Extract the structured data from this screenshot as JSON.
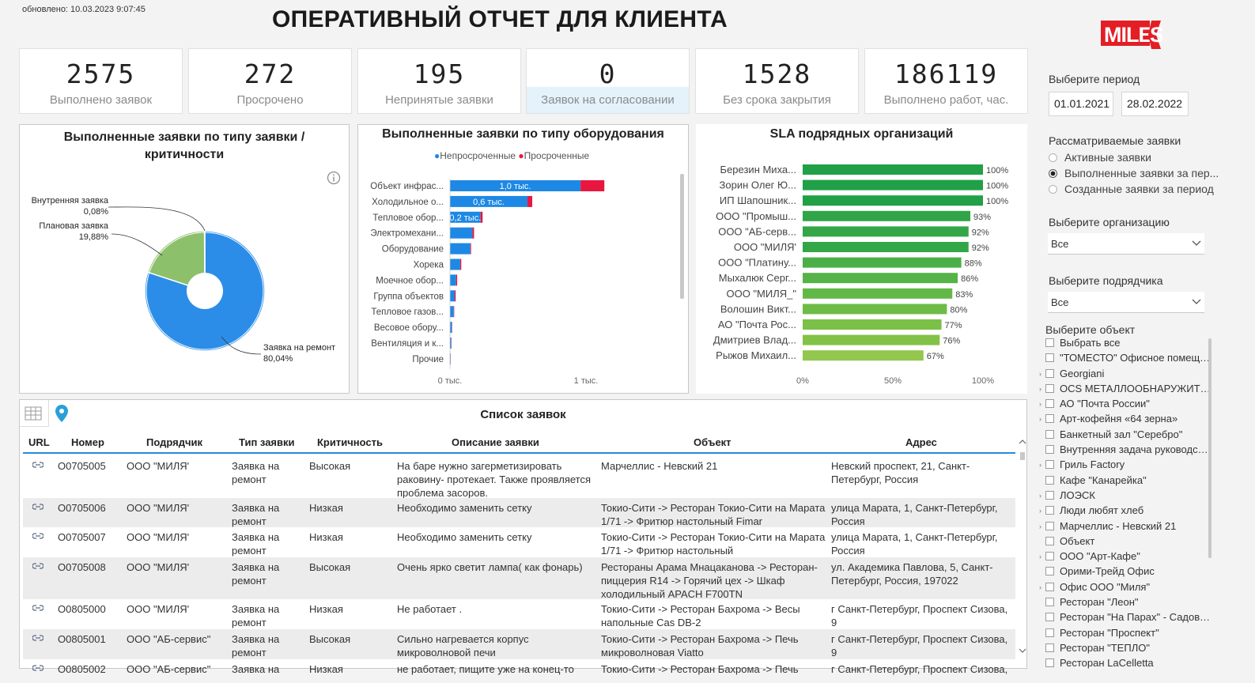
{
  "header": {
    "updated": "обновлено: 10.03.2023 9:07:45",
    "title": "ОПЕРАТИВНЫЙ ОТЧЕТ ДЛЯ КЛИЕНТА",
    "logo_text": "MILES",
    "logo_color": "#e31e24"
  },
  "kpis": [
    {
      "value": "2575",
      "label": "Выполнено заявок"
    },
    {
      "value": "272",
      "label": "Просрочено"
    },
    {
      "value": "195",
      "label": "Непринятые заявки"
    },
    {
      "value": "0",
      "label": "Заявок на согласовании"
    },
    {
      "value": "1528",
      "label": "Без срока закрытия"
    },
    {
      "value": "186119",
      "label": "Выполнено работ, час."
    }
  ],
  "pie": {
    "title": "Выполненные заявки по типу заявки / критичности",
    "slices": [
      {
        "label": "Заявка на ремонт",
        "pct": "80,04%",
        "value": 80.04,
        "color": "#2b8de8"
      },
      {
        "label": "Плановая заявка",
        "pct": "19,88%",
        "value": 19.88,
        "color": "#8cc06b"
      },
      {
        "label": "Внутренняя заявка",
        "pct": "0,08%",
        "value": 0.08,
        "color": "#555555"
      }
    ]
  },
  "equip": {
    "title": "Выполненные заявки по типу оборудования",
    "legend": [
      "Непросроченные",
      "Просроченные"
    ],
    "colors": [
      "#1e88e5",
      "#e8173f"
    ],
    "categories": [
      "Объект инфрас...",
      "Холодильное о...",
      "Тепловое обор...",
      "Электромехани...",
      "Оборудование",
      "Хорека",
      "Моечное обор...",
      "Группа объектов",
      "Тепловое газов...",
      "Весовое обору...",
      "Вентиляция и к...",
      "Прочие"
    ],
    "ontime": [
      960,
      570,
      225,
      165,
      150,
      75,
      45,
      35,
      28,
      14,
      9,
      5
    ],
    "overdue": [
      175,
      35,
      15,
      12,
      5,
      8,
      8,
      7,
      3,
      2,
      2,
      1
    ],
    "data_labels": [
      "1,0 тыс.",
      "0,6 тыс.",
      "0,2 тыс."
    ],
    "xticks": [
      "0 тыс.",
      "1 тыс."
    ],
    "xmax": 1000
  },
  "sla": {
    "title": "SLA подрядных организаций",
    "names": [
      "Березин Миха...",
      "Зорин Олег Ю...",
      "ИП Шапошник...",
      "ООО \"Промыш...",
      "ООО \"АБ-серв...",
      "ООО \"МИЛЯ'",
      "ООО \"Платину...",
      "Мыхалюк Серг...",
      "ООО \"МИЛЯ_\"",
      "Волошин Викт...",
      "АО \"Почта Рос...",
      "Дмитриев Влад...",
      "Рыжов Михаил..."
    ],
    "values": [
      100,
      100,
      100,
      93,
      92,
      92,
      88,
      86,
      83,
      80,
      77,
      76,
      67
    ],
    "labels": [
      "100%",
      "100%",
      "100%",
      "93%",
      "92%",
      "92%",
      "88%",
      "86%",
      "83%",
      "80%",
      "77%",
      "76%",
      "67%"
    ],
    "xticks": [
      "0%",
      "50%",
      "100%"
    ]
  },
  "filters": {
    "period_label": "Выберите период",
    "date_from": "01.01.2021",
    "date_to": "28.02.2022",
    "requests_label": "Рассматриваемые заявки",
    "radios": [
      "Активные заявки",
      "Выполненные заявки за пер...",
      "Созданные заявки за период"
    ],
    "org_label": "Выберите организацию",
    "org_value": "Все",
    "contractor_label": "Выберите подрядчика",
    "contractor_value": "Все",
    "object_label": "Выберите объект",
    "objects": [
      {
        "t": "Выбрать все",
        "c": false
      },
      {
        "t": "\"ТОМЕСТО\" Офисное помещен...",
        "c": false
      },
      {
        "t": "Georgiani",
        "c": true
      },
      {
        "t": "OCS МЕТАЛЛООБНАРУЖИТЕЛИ",
        "c": true
      },
      {
        "t": "АО \"Почта России\"",
        "c": true
      },
      {
        "t": "Арт-кофейня «64 зерна»",
        "c": true
      },
      {
        "t": "Банкетный зал \"Серебро\"",
        "c": false
      },
      {
        "t": "Внутренняя задача руководства",
        "c": false
      },
      {
        "t": "Гриль Factory",
        "c": true
      },
      {
        "t": "Кафе \"Канарейка\"",
        "c": false
      },
      {
        "t": "ЛОЭСК",
        "c": true
      },
      {
        "t": "Люди любят хлеб",
        "c": true
      },
      {
        "t": "Марчеллис - Невский 21",
        "c": true
      },
      {
        "t": "Объект",
        "c": false
      },
      {
        "t": "ООО \"Арт-Кафе\"",
        "c": true
      },
      {
        "t": "Орими-Трейд Офис",
        "c": false
      },
      {
        "t": "Офис ООО \"Миля\"",
        "c": true
      },
      {
        "t": "Ресторан \"Леон\"",
        "c": false
      },
      {
        "t": "Ресторан \"На Парах\" - Садовая...",
        "c": false
      },
      {
        "t": "Ресторан \"Проспект\"",
        "c": false
      },
      {
        "t": "Ресторан \"ТЕПЛО\"",
        "c": false
      },
      {
        "t": "Ресторан LaCelletta",
        "c": false
      }
    ]
  },
  "table": {
    "title": "Список заявок",
    "headers": [
      "URL",
      "Номер",
      "Подрядчик",
      "Тип заявки",
      "Критичность",
      "Описание заявки",
      "Объект",
      "Адрес"
    ],
    "rows": [
      {
        "num": "O0705005",
        "contractor": "ООО \"МИЛЯ'",
        "type": "Заявка на ремонт",
        "crit": "Высокая",
        "desc": "На баре нужно загерметизировать раковину- протекает. Также проявляется проблема засоров.",
        "obj": "Марчеллис - Невский 21",
        "addr": "Невский проспект, 21, Санкт-Петербург, Россия"
      },
      {
        "num": "O0705006",
        "contractor": "ООО \"МИЛЯ'",
        "type": "Заявка на ремонт",
        "crit": "Низкая",
        "desc": "Необходимо заменить сетку",
        "obj": "Токио-Сити -> Ресторан Токио-Сити на Марата 1/71 -> Фритюр настольный Fimar",
        "addr": "улица Марата, 1, Санкт-Петербург, Россия"
      },
      {
        "num": "O0705007",
        "contractor": "ООО \"МИЛЯ'",
        "type": "Заявка на ремонт",
        "crit": "Низкая",
        "desc": "Необходимо заменить сетку",
        "obj": "Токио-Сити -> Ресторан Токио-Сити на Марата 1/71 -> Фритюр настольный",
        "addr": "улица Марата, 1, Санкт-Петербург, Россия"
      },
      {
        "num": "O0705008",
        "contractor": "ООО \"МИЛЯ'",
        "type": "Заявка на ремонт",
        "crit": "Высокая",
        "desc": "Очень ярко светит лампа( как фонарь)",
        "obj": "Рестораны Арама Мнацаканова -> Ресторан-пиццерия R14 -> Горячий цех -> Шкаф холодильный APACH F700TN",
        "addr": "ул. Академика Павлова, 5, Санкт-Петербург, Россия, 197022"
      },
      {
        "num": "O0805000",
        "contractor": "ООО \"МИЛЯ'",
        "type": "Заявка на ремонт",
        "crit": "Низкая",
        "desc": "Не работает .",
        "obj": "Токио-Сити -> Ресторан Бахрома -> Весы напольные Cas DB-2",
        "addr": "г Санкт-Петербург, Проспект Сизова, 9"
      },
      {
        "num": "O0805001",
        "contractor": "ООО \"АБ-сервис\"",
        "type": "Заявка на ремонт",
        "crit": "Высокая",
        "desc": "Сильно нагревается корпус микроволновой печи",
        "obj": "Токио-Сити -> Ресторан Бахрома -> Печь микроволновая Viatto",
        "addr": "г Санкт-Петербург, Проспект Сизова, 9"
      },
      {
        "num": "O0805002",
        "contractor": "ООО \"АБ-сервис\"",
        "type": "Заявка на ремонт",
        "crit": "Низкая",
        "desc": "не работает, пищите уже на конец-то",
        "obj": "Токио-Сити -> Ресторан Бахрома -> Печь",
        "addr": "г Санкт-Петербург, Проспект Сизова,"
      }
    ]
  }
}
